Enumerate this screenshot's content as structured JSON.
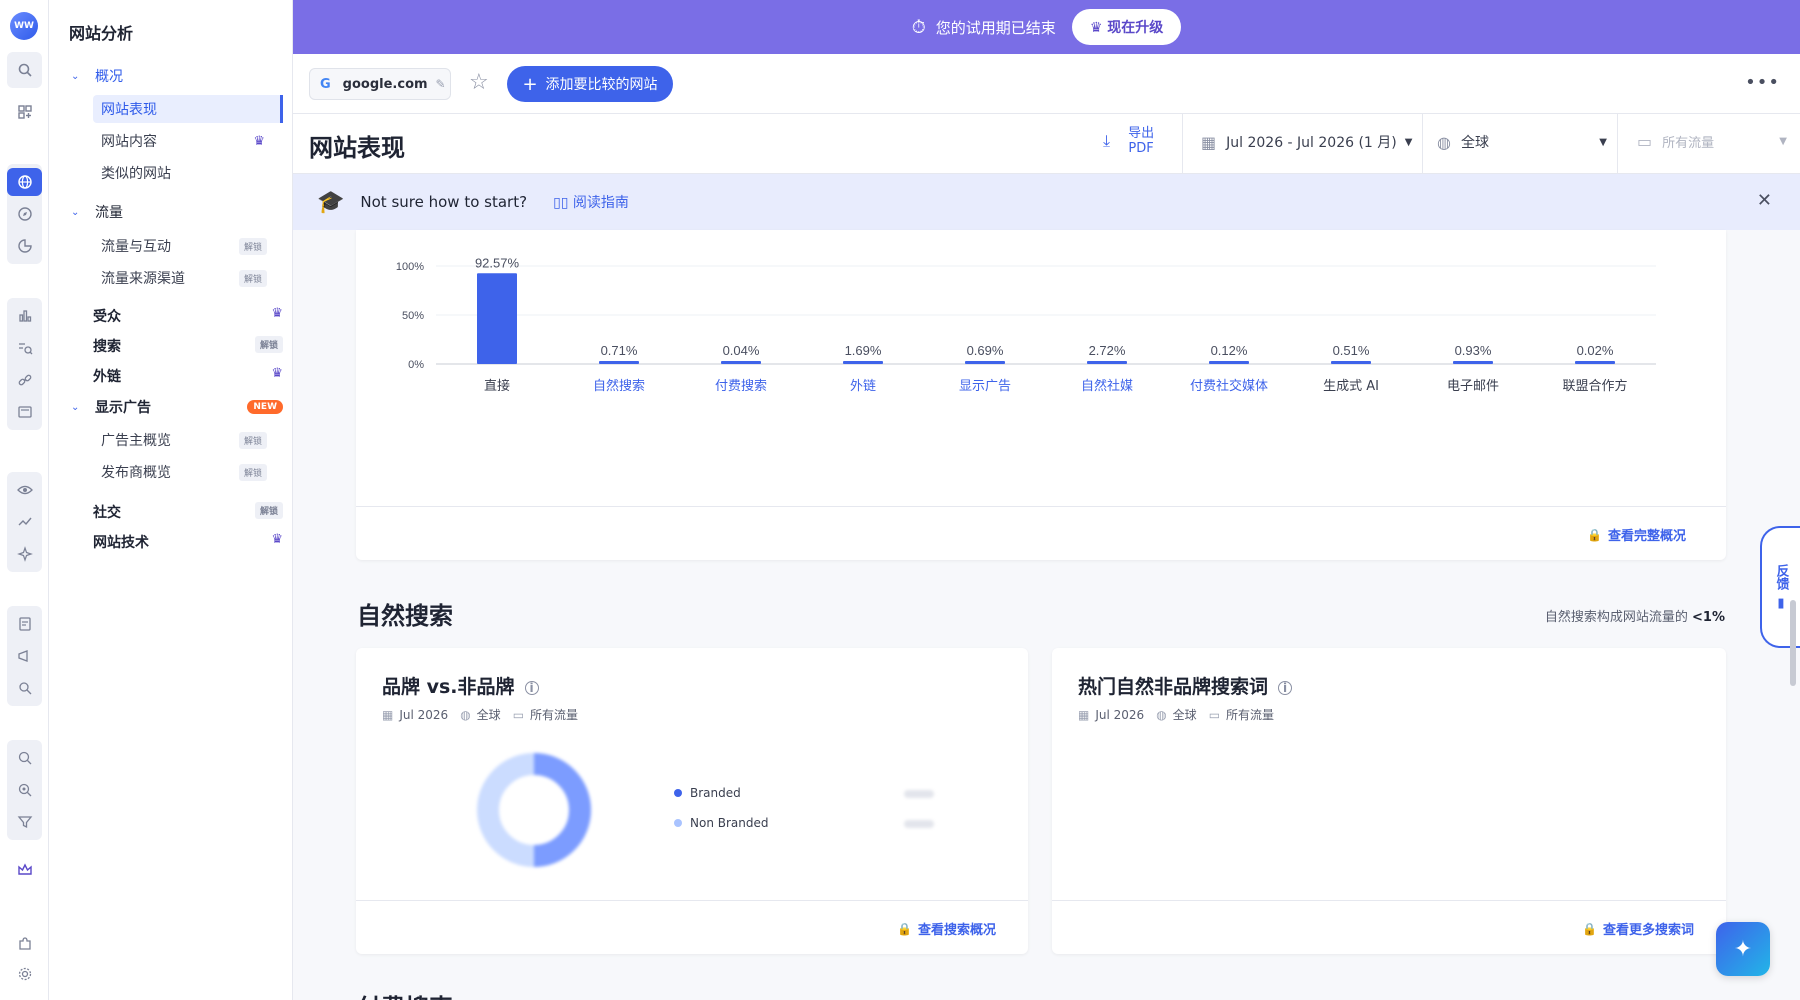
{
  "trial": {
    "message": "您的试用期已结束",
    "upgrade_label": "现在升级"
  },
  "domain": {
    "favicon": "G",
    "name": "google.com",
    "add_compare_label": "添加要比较的网站"
  },
  "page": {
    "title": "网站表现",
    "export_line1": "导出",
    "export_line2": "PDF",
    "date_range": "Jul 2026 - Jul 2026 (1 月)",
    "region": "全球",
    "traffic": "所有流量"
  },
  "guide": {
    "question": "Not sure how to start?",
    "read_label": "阅读指南"
  },
  "sidebar": {
    "title": "网站分析",
    "overview": "概况",
    "overview_items": [
      {
        "label": "网站表现"
      },
      {
        "label": "网站内容"
      },
      {
        "label": "类似的网站"
      }
    ],
    "traffic": "流量",
    "traffic_items": [
      {
        "label": "流量与互动",
        "badge": "解锁"
      },
      {
        "label": "流量来源渠道",
        "badge": "解锁"
      }
    ],
    "audience": "受众",
    "search": "搜索",
    "search_badge": "解锁",
    "backlinks": "外链",
    "display_ads": "显示广告",
    "new_badge": "NEW",
    "ads_items": [
      {
        "label": "广告主概览",
        "badge": "解锁"
      },
      {
        "label": "发布商概览",
        "badge": "解锁"
      }
    ],
    "social": "社交",
    "social_badge": "解锁",
    "tech": "网站技术"
  },
  "chart_data": {
    "type": "bar",
    "categories": [
      "直接",
      "自然搜索",
      "付费搜索",
      "外链",
      "显示广告",
      "自然社媒",
      "付费社交媒体",
      "生成式 AI",
      "电子邮件",
      "联盟合作方"
    ],
    "values": [
      92.57,
      0.71,
      0.04,
      1.69,
      0.69,
      2.72,
      0.12,
      0.51,
      0.93,
      0.02
    ],
    "value_labels": [
      "92.57%",
      "0.71%",
      "0.04%",
      "1.69%",
      "0.69%",
      "2.72%",
      "0.12%",
      "0.51%",
      "0.93%",
      "0.02%"
    ],
    "yticks": [
      "100%",
      "50%",
      "0%"
    ],
    "ylim": [
      0,
      100
    ],
    "color": "#3e63ea",
    "link_categories": [
      false,
      true,
      true,
      true,
      true,
      true,
      true,
      false,
      false,
      false
    ]
  },
  "chart_footer": {
    "link_label": "查看完整概况"
  },
  "organic": {
    "title": "自然搜索",
    "note_prefix": "自然搜索构成网站流量的",
    "note_value": "<1%",
    "brand_card": {
      "title": "品牌 vs.非品牌",
      "date": "Jul 2026",
      "region": "全球",
      "traffic": "所有流量",
      "legend": [
        "Branded",
        "Non Branded"
      ],
      "colors": [
        "#3e63ea",
        "#a9c3ff"
      ],
      "link_label": "查看搜索概况"
    },
    "keywords_card": {
      "title": "热门自然非品牌搜索词",
      "date": "Jul 2026",
      "region": "全球",
      "traffic": "所有流量",
      "link_label": "查看更多搜索词"
    }
  },
  "feedback": {
    "label": "反馈"
  },
  "next_section": "付费搜索"
}
